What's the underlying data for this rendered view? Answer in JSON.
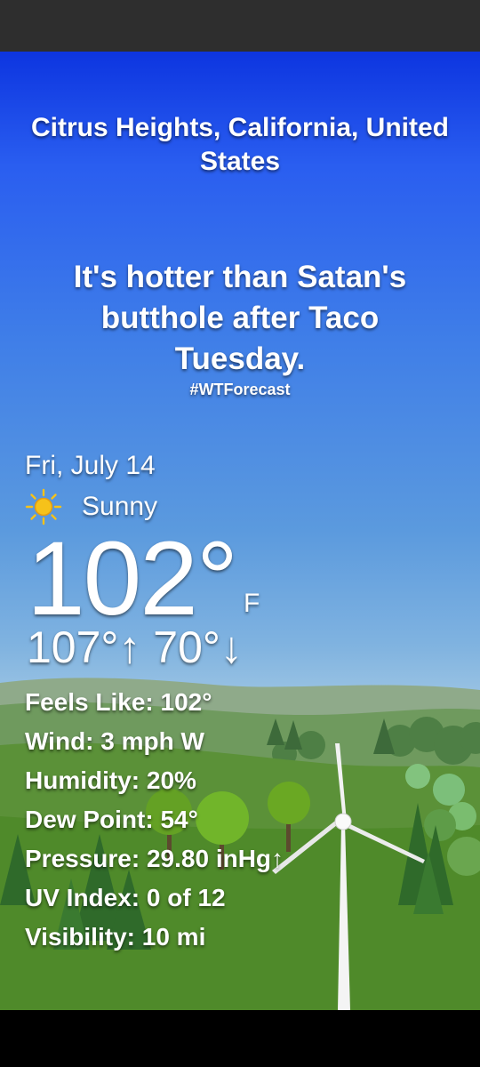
{
  "location": {
    "line1": "Citrus Heights, California, United",
    "line2": "States"
  },
  "quip": {
    "line1": "It's hotter than Satan's",
    "line2": "butthole after Taco",
    "line3": "Tuesday."
  },
  "hashtag": "#WTForecast",
  "date": "Fri, July 14",
  "condition": {
    "icon": "sun-icon",
    "label": "Sunny"
  },
  "temperature": {
    "value": "102°",
    "unit": "F"
  },
  "high_low": "107°↑ 70°↓",
  "details": [
    "Feels Like:  102°",
    "Wind:  3 mph W",
    "Humidity:  20%",
    "Dew Point:  54°",
    "Pressure:  29.80 inHg↑",
    "UV Index:  0 of 12",
    "Visibility:  10 mi"
  ],
  "colors": {
    "sky_top": "#0d35e0",
    "sky_bottom": "#c9dfe9",
    "grass": "#4f8a2a",
    "sun": "#f6c21a"
  }
}
